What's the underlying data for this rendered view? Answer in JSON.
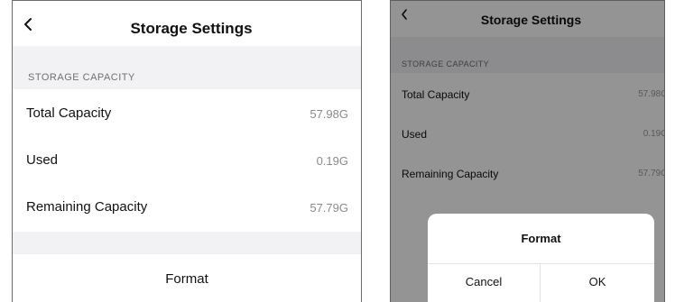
{
  "left_screen": {
    "header": {
      "title": "Storage Settings",
      "back_icon": "chevron-left-icon"
    },
    "section_label": "STORAGE CAPACITY",
    "rows": [
      {
        "label": "Total Capacity",
        "value": "57.98G"
      },
      {
        "label": "Used",
        "value": "0.19G"
      },
      {
        "label": "Remaining Capacity",
        "value": "57.79G"
      }
    ],
    "format_label": "Format"
  },
  "right_screen": {
    "header": {
      "title": "Storage Settings",
      "back_icon": "chevron-left-icon"
    },
    "section_label": "STORAGE CAPACITY",
    "rows": [
      {
        "label": "Total Capacity",
        "value": "57.98G"
      },
      {
        "label": "Used",
        "value": "0.19G"
      },
      {
        "label": "Remaining Capacity",
        "value": "57.79G"
      }
    ],
    "dialog": {
      "title": "Format",
      "cancel_label": "Cancel",
      "ok_label": "OK"
    }
  },
  "colors": {
    "background": "#ffffff",
    "section_gap": "#f2f2f4",
    "value_text": "#8a8a8a",
    "overlay": "rgba(0,0,0,0.42)"
  }
}
